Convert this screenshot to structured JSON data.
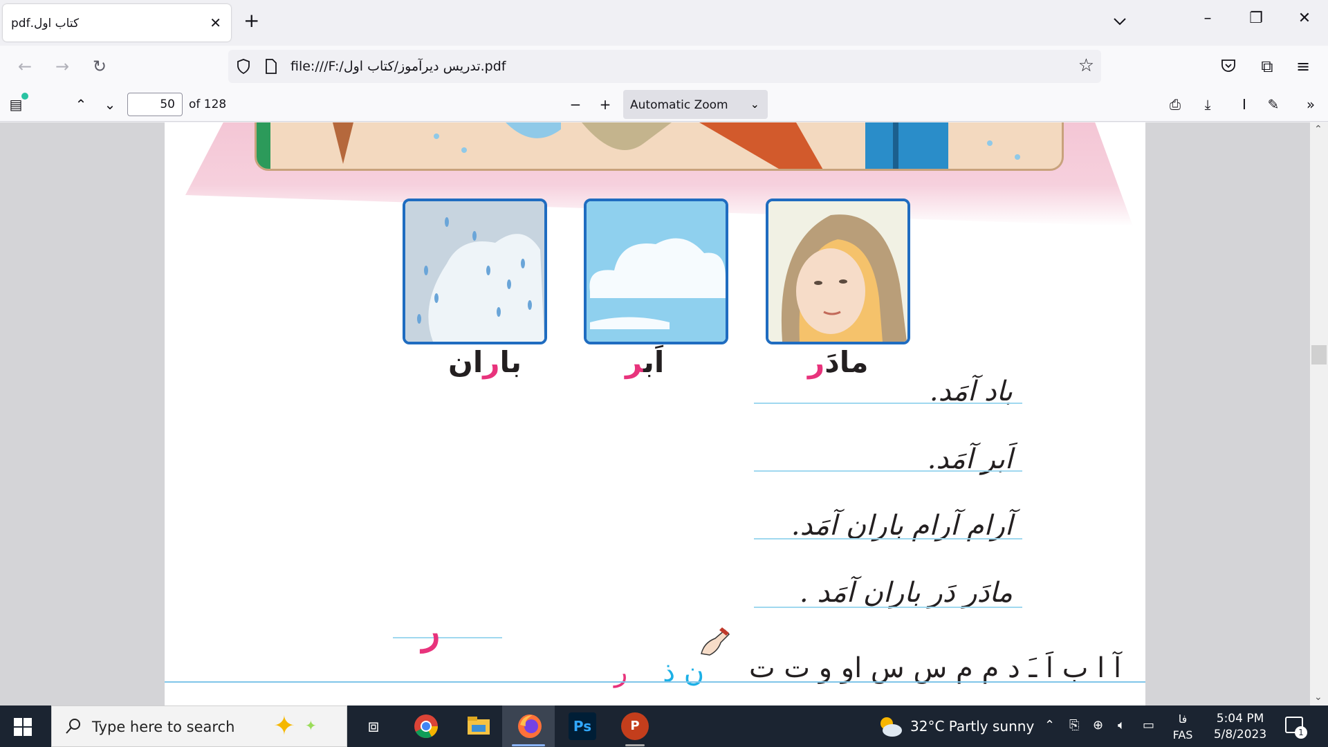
{
  "browser": {
    "tab_title": "کتاب اول.pdf",
    "url": "file:///F:/تدریس دیرآموز/کتاب اول.pdf"
  },
  "pdf_toolbar": {
    "page_number": "50",
    "page_count": "of 128",
    "zoom": "Automatic Zoom"
  },
  "book": {
    "cards": [
      {
        "word_plain": "با",
        "word_hl": "ر",
        "word_rest": "ان",
        "label": "باران"
      },
      {
        "word_plain": "اَب",
        "word_hl": "ر",
        "word_rest": "",
        "label": "اَبر"
      },
      {
        "word_plain": "مادَ",
        "word_hl": "ر",
        "word_rest": "",
        "label": "مادَر"
      }
    ],
    "sentences": [
      "باد آمَد.",
      "اَبر آمَد.",
      "آرام آرام باران آمَد.",
      "مادَر دَر باران آمَد ."
    ],
    "practice_letter": "ر",
    "alphabet": "آ ا ب اَ ـَ د م م س س او و ت ت",
    "alphabet_color_red": "ر",
    "alphabet_color_blue": "ن ذ",
    "colors": {
      "highlight": "#e8337c",
      "frame": "#1f6cc0",
      "line": "#9fd8ef"
    }
  },
  "taskbar": {
    "search_placeholder": "Type here to search",
    "weather": "32°C  Partly sunny",
    "lang_top": "فا",
    "lang_bottom": "FAS",
    "time": "5:04 PM",
    "date": "5/8/2023",
    "notifications": "1"
  }
}
